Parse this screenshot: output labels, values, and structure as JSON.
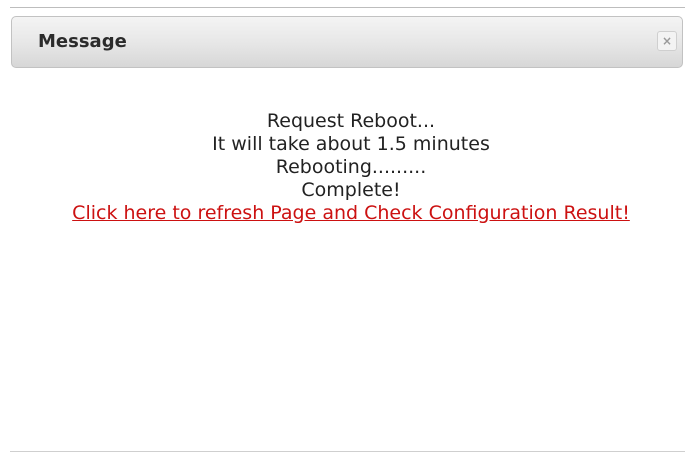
{
  "dialog": {
    "title": "Message",
    "close_label": "×"
  },
  "body": {
    "lines": [
      "Request Reboot...",
      "It will take about 1.5 minutes",
      "Rebooting.........",
      "Complete!"
    ],
    "link_text": "Click here to refresh Page and Check Configuration Result!"
  },
  "colors": {
    "link": "#cc1111",
    "text": "#222222"
  }
}
